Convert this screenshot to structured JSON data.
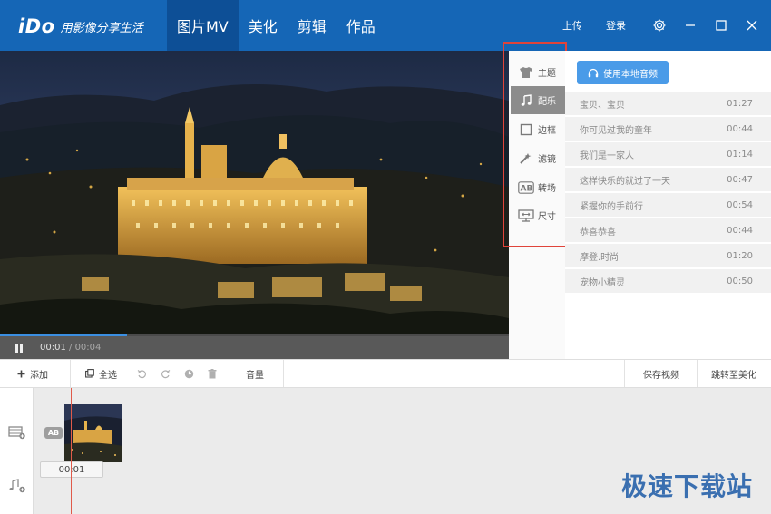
{
  "app": {
    "logo_text": "iDo",
    "slogan": "用影像分享生活"
  },
  "nav": {
    "tabs": [
      {
        "label": "图片MV",
        "active": true
      },
      {
        "label": "美化",
        "active": false
      },
      {
        "label": "剪辑",
        "active": false
      },
      {
        "label": "作品",
        "active": false
      }
    ]
  },
  "header_actions": {
    "upload": "上传",
    "login": "登录"
  },
  "player": {
    "current_time": "00:01",
    "separator": " / ",
    "total_time": "00:04",
    "progress_fraction": 0.25
  },
  "side_menu": {
    "items": [
      {
        "label": "主题",
        "icon": "tshirt-icon",
        "active": false
      },
      {
        "label": "配乐",
        "icon": "music-note-icon",
        "active": true
      },
      {
        "label": "边框",
        "icon": "frame-icon",
        "active": false
      },
      {
        "label": "滤镜",
        "icon": "magic-wand-icon",
        "active": false
      },
      {
        "label": "转场",
        "icon": "transition-icon",
        "active": false
      },
      {
        "label": "尺寸",
        "icon": "monitor-icon",
        "active": false
      }
    ]
  },
  "music": {
    "local_button": "使用本地音频",
    "songs": [
      {
        "title": "宝贝、宝贝",
        "duration": "01:27"
      },
      {
        "title": "你可见过我的童年",
        "duration": "00:44"
      },
      {
        "title": "我们是一家人",
        "duration": "01:14"
      },
      {
        "title": "这样快乐的就过了一天",
        "duration": "00:47"
      },
      {
        "title": "紧握你的手前行",
        "duration": "00:54"
      },
      {
        "title": "恭喜恭喜",
        "duration": "00:44"
      },
      {
        "title": "摩登.时尚",
        "duration": "01:20"
      },
      {
        "title": "宠物小精灵",
        "duration": "00:50"
      }
    ]
  },
  "toolbar": {
    "add": "添加",
    "select_all": "全选",
    "volume": "音量",
    "save_video": "保存视频",
    "goto_beautify": "跳转至美化"
  },
  "timeline": {
    "transition_badge": "AB",
    "clip_duration": "00:01"
  },
  "watermark": "极速下载站",
  "colors": {
    "title_bar": "#1566b6",
    "active_tab": "#0d4f96",
    "accent_button": "#4a9be8",
    "highlight_frame": "#e0443a"
  }
}
